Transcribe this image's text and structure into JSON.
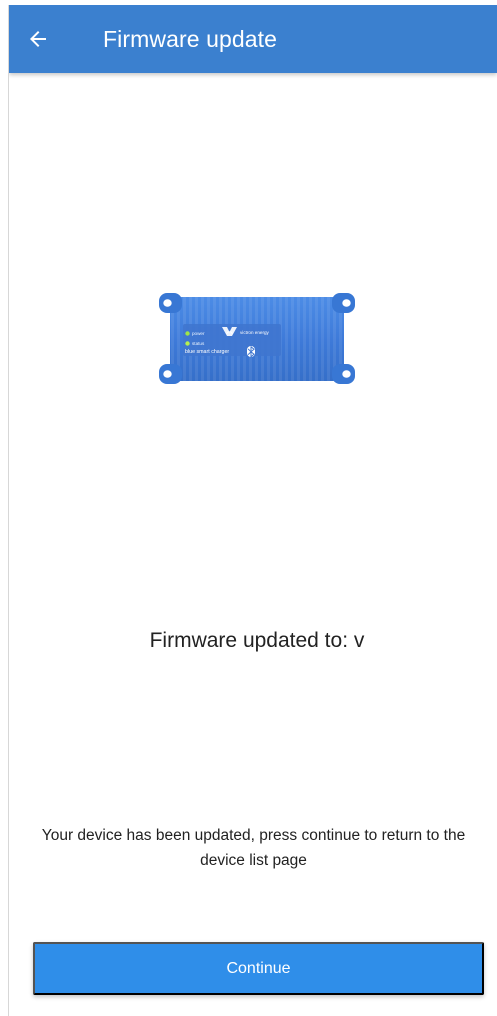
{
  "header": {
    "title": "Firmware update",
    "back_icon": "arrow-left-icon",
    "background_color": "#3b80cf",
    "text_color": "#ffffff"
  },
  "device": {
    "image_icon": "blue-smart-charger-image",
    "labels": {
      "power": "power",
      "status": "status",
      "brand": "victron energy",
      "model": "blue smart charger"
    }
  },
  "content": {
    "updated_label": "Firmware updated to: ",
    "updated_version": "v",
    "description": "Your device has been updated, press continue to return to the device list page"
  },
  "actions": {
    "continue_label": "Continue",
    "continue_color": "#2f8ee9"
  }
}
